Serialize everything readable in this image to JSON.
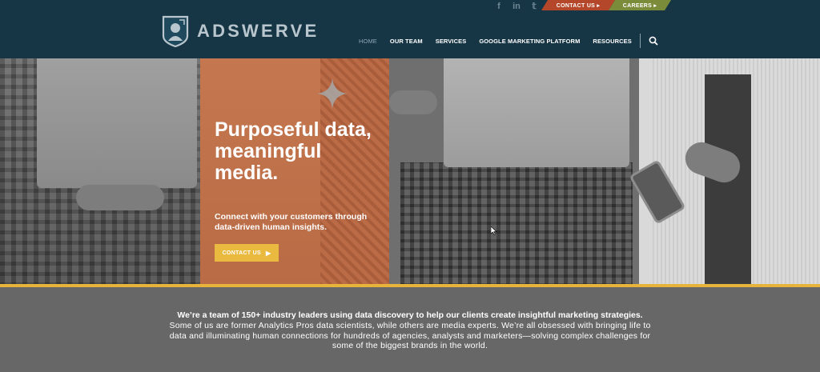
{
  "brand": {
    "name": "ADSWERVE",
    "colors": {
      "header_bg": "#163646",
      "accent_gold": "#e8b33a",
      "contact_tab": "#b4472a",
      "careers_tab": "#7a8b3a",
      "hero_overlay": "#c5774f"
    }
  },
  "social": [
    {
      "icon": "facebook-icon",
      "glyph": "f"
    },
    {
      "icon": "linkedin-icon",
      "glyph": "in"
    },
    {
      "icon": "twitter-icon",
      "glyph": "𝕥"
    }
  ],
  "top_tabs": {
    "contact": "CONTACT US ▸",
    "careers": "CAREERS ▸"
  },
  "nav": {
    "items": [
      "HOME",
      "OUR TEAM",
      "SERVICES",
      "GOOGLE MARKETING PLATFORM",
      "RESOURCES"
    ],
    "active": "HOME"
  },
  "hero": {
    "title": "Purposeful data, meaningful media.",
    "subtitle": "Connect with your customers through data-driven human insights.",
    "cta": "CONTACT US"
  },
  "about": {
    "lead": "We’re a team of 150+ industry leaders using data discovery to help our clients create insightful marketing strategies.",
    "body": "Some of us are former Analytics Pros data scientists, while others are media experts. We’re all obsessed with bringing life to data and illuminating human connections for hundreds of agencies, analysts and marketers—solving complex challenges for some of the biggest brands in the world."
  }
}
